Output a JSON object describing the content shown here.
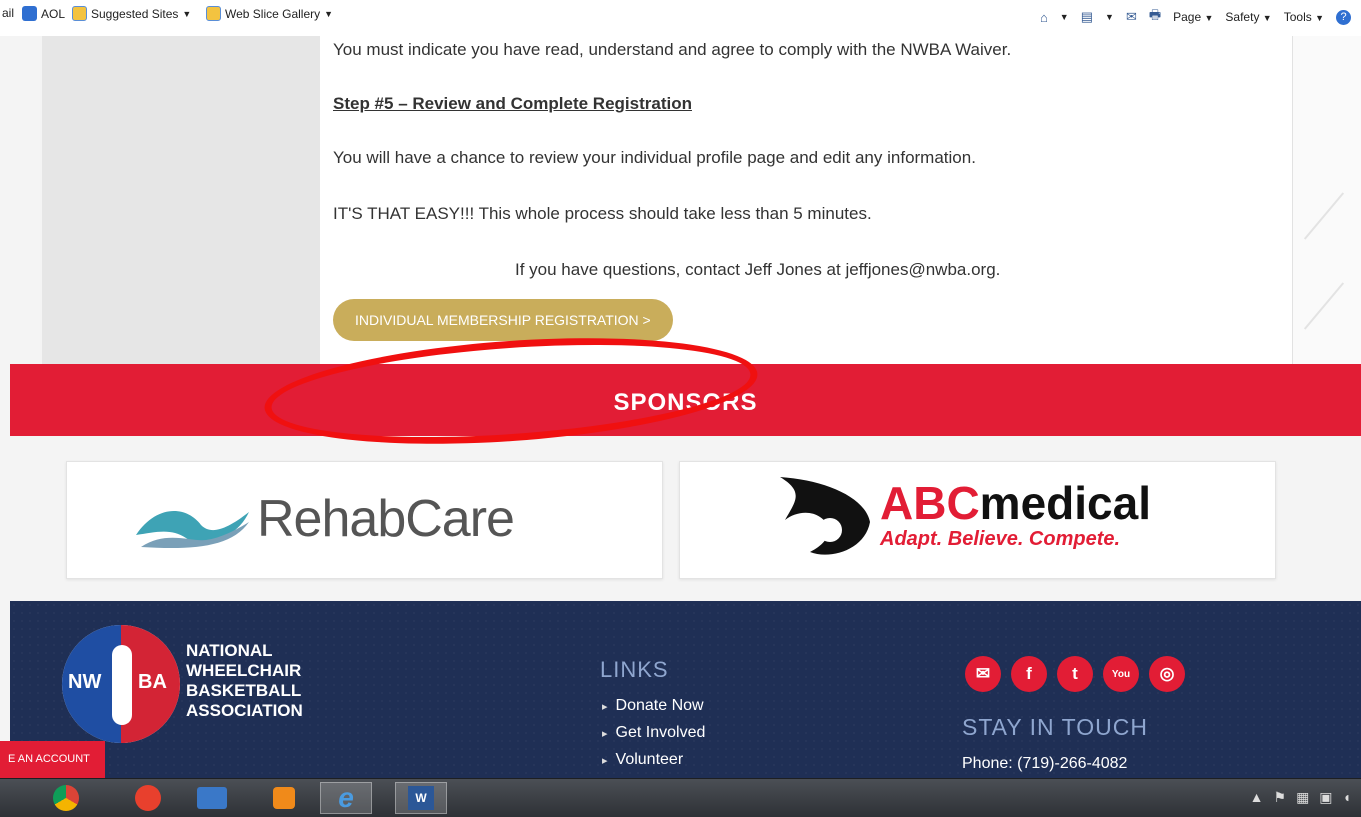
{
  "ie_toolbar": {
    "favorites": [
      {
        "label": "ail",
        "icon": "mail-partial"
      },
      {
        "label": "AOL",
        "icon": "aol-icon"
      },
      {
        "label": "Suggested Sites",
        "icon": "ie-page-icon",
        "dropdown": true
      },
      {
        "label": "Web Slice Gallery",
        "icon": "ie-page-icon",
        "dropdown": true
      }
    ],
    "commands": {
      "home": "⌂",
      "feeds": "▤",
      "mail": "✉",
      "print": "🖶",
      "page": "Page",
      "safety": "Safety",
      "tools": "Tools",
      "help": "?"
    }
  },
  "content": {
    "waiver_text": "You must indicate you have read, understand and agree to comply with the NWBA Waiver.",
    "step5_heading": "Step #5 – Review and Complete Registration",
    "review_text": "You will have a chance to review your individual profile page and edit any information.",
    "easy_text": "IT'S THAT EASY!!! This whole process should take less than  5 minutes.",
    "contact_text": "If you have questions, contact Jeff Jones at jeffjones@nwba.org.",
    "register_button": "INDIVIDUAL MEMBERSHIP REGISTRATION  >"
  },
  "sponsors": {
    "title": "SPONSORS",
    "rehabcare": "RehabCare",
    "abc_brand_red": "ABC",
    "abc_brand_black": "medical",
    "abc_tagline": "Adapt. Believe. Compete."
  },
  "footer": {
    "logo_left": "NW",
    "logo_right": "BA",
    "org_line1": "NATIONAL",
    "org_line2": "WHEELCHAIR",
    "org_line3": "BASKETBALL",
    "org_line4": "ASSOCIATION",
    "links_title": "LINKS",
    "links": [
      "Donate Now",
      "Get Involved",
      "Volunteer"
    ],
    "social_icons": [
      "email-icon",
      "facebook-icon",
      "twitter-icon",
      "youtube-icon",
      "instagram-icon"
    ],
    "stay_title": "STAY IN TOUCH",
    "phone": "Phone: (719)-266-4082",
    "create_account": "E AN ACCOUNT"
  },
  "colors": {
    "accent_red": "#e21d35",
    "button_gold": "#c9ad5b",
    "footer_navy": "#1f2f55",
    "annotation_red": "#f01010"
  },
  "taskbar": {
    "apps": [
      "chrome-icon",
      "creative-cloud-icon",
      "lenovo-icon",
      "media-player-icon",
      "internet-explorer-icon",
      "word-icon"
    ]
  }
}
